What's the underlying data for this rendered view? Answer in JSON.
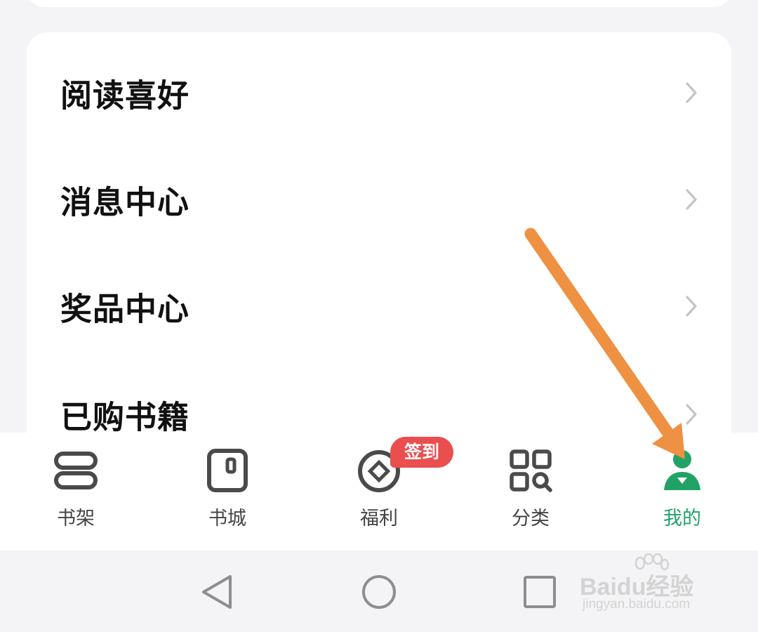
{
  "menu": {
    "items": [
      {
        "label": "阅读喜好",
        "icon": "chevron-right-icon"
      },
      {
        "label": "消息中心",
        "icon": "chevron-right-icon"
      },
      {
        "label": "奖品中心",
        "icon": "chevron-right-icon"
      },
      {
        "label": "已购书籍",
        "icon": "chevron-right-icon"
      }
    ]
  },
  "tabbar": {
    "tabs": [
      {
        "label": "书架",
        "icon": "bookshelf-icon",
        "active": false
      },
      {
        "label": "书城",
        "icon": "bookstore-icon",
        "active": false
      },
      {
        "label": "福利",
        "icon": "welfare-coin-icon",
        "active": false
      },
      {
        "label": "分类",
        "icon": "category-grid-icon",
        "active": false
      },
      {
        "label": "我的",
        "icon": "profile-person-icon",
        "active": true
      }
    ],
    "badge": "签到"
  },
  "system_nav": {
    "buttons": [
      "back-triangle-icon",
      "home-circle-icon",
      "recents-square-icon"
    ]
  },
  "watermark": {
    "brand_prefix": "Bai",
    "brand_paw": "du",
    "brand_suffix": "经验",
    "url": "jingyan.baidu.com"
  },
  "colors": {
    "active_green": "#21a366",
    "badge_red": "#ea4e4e",
    "annotation_arrow": "#ee9142",
    "label_dark": "#111111",
    "icon_gray": "#4a4a4a"
  }
}
